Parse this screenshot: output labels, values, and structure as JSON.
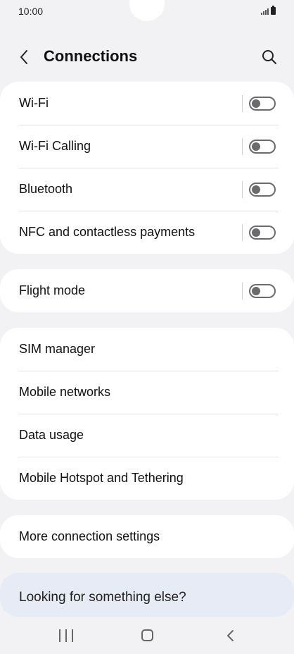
{
  "status_bar": {
    "time": "10:00"
  },
  "header": {
    "title": "Connections",
    "back_icon": "chevron-left-icon",
    "search_icon": "search-icon"
  },
  "groups": [
    {
      "items": [
        {
          "label": "Wi-Fi",
          "toggle": false
        },
        {
          "label": "Wi-Fi Calling",
          "toggle": false
        },
        {
          "label": "Bluetooth",
          "toggle": false
        },
        {
          "label": "NFC and contactless payments",
          "toggle": false
        }
      ]
    },
    {
      "items": [
        {
          "label": "Flight mode",
          "toggle": false
        }
      ]
    },
    {
      "items": [
        {
          "label": "SIM manager"
        },
        {
          "label": "Mobile networks"
        },
        {
          "label": "Data usage"
        },
        {
          "label": "Mobile Hotspot and Tethering"
        }
      ]
    },
    {
      "items": [
        {
          "label": "More connection settings"
        }
      ]
    }
  ],
  "suggestion": {
    "text": "Looking for something else?"
  },
  "nav_bar": {
    "recents_icon": "recents-icon",
    "home_icon": "home-icon",
    "back_icon": "back-icon"
  },
  "colors": {
    "background": "#f2f2f4",
    "card": "#ffffff",
    "suggestion_card": "#e7ebf5",
    "toggle_off": "#6b6b6e"
  }
}
